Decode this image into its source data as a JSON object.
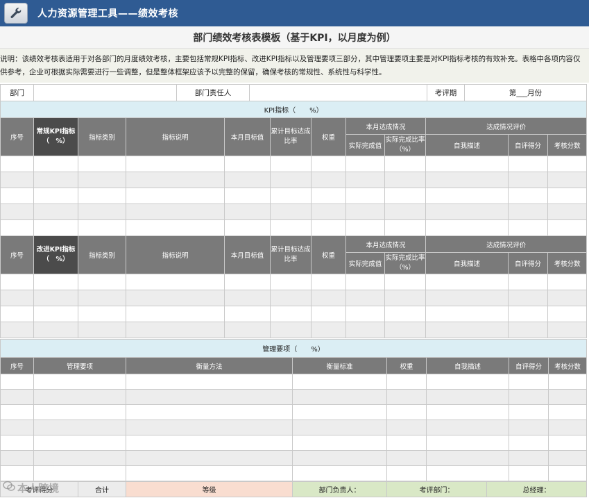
{
  "header": {
    "app_title": "人力资源管理工具——绩效考核",
    "icon": "wrench-icon"
  },
  "page_title": "部门绩效考核表模板（基于KPI，以月度为例）",
  "note": "说明：该绩效考核表适用于对各部门的月度绩效考核，主要包括常规KPI指标、改进KPI指标以及管理要项三部分，其中管理要项主要是对KPI指标考核的有效补充。表格中各项内容仅供参考，企业可根据实际需要进行一些调整，但是整体框架应该予以完整的保留，确保考核的常规性、系统性与科学性。",
  "info_row": {
    "dept_label": "部门",
    "dept_value": "",
    "manager_label": "部门责任人",
    "manager_value": "",
    "period_label": "考评期",
    "period_value": "第___月份"
  },
  "kpi_section": {
    "title": "KPI指标（　　%）",
    "headers": {
      "no": "序号",
      "regular_kpi": "常规KPI指标（　%）",
      "improve_kpi": "改进KPI指标（　%）",
      "category": "指标类别",
      "description": "指标说明",
      "target": "本月目标值",
      "cum_rate": "累计目标达成比率",
      "weight": "权重",
      "month_achieve": "本月达成情况",
      "actual_value": "实际完成值",
      "actual_rate": "实际完成比率（%）",
      "eval": "达成情况评价",
      "self_desc": "自我描述",
      "self_score": "自评得分",
      "assess_score": "考核分数"
    }
  },
  "mgmt_section": {
    "title": "管理要项（　　%）",
    "headers": {
      "no": "序号",
      "item": "管理要项",
      "method": "衡量方法",
      "standard": "衡量标准",
      "weight": "权重",
      "self_desc": "自我描述",
      "self_score": "自评得分",
      "assess_score": "考核分数"
    }
  },
  "footer": {
    "score_label": "考评得分",
    "total_label": "合计",
    "grade_label": "等级",
    "dept_head_label": "部门负责人：",
    "eval_dept_label": "考评部门：",
    "gm_label": "总经理："
  },
  "watermark": {
    "text": "本人跨境",
    "icon": "wechat-icon"
  }
}
